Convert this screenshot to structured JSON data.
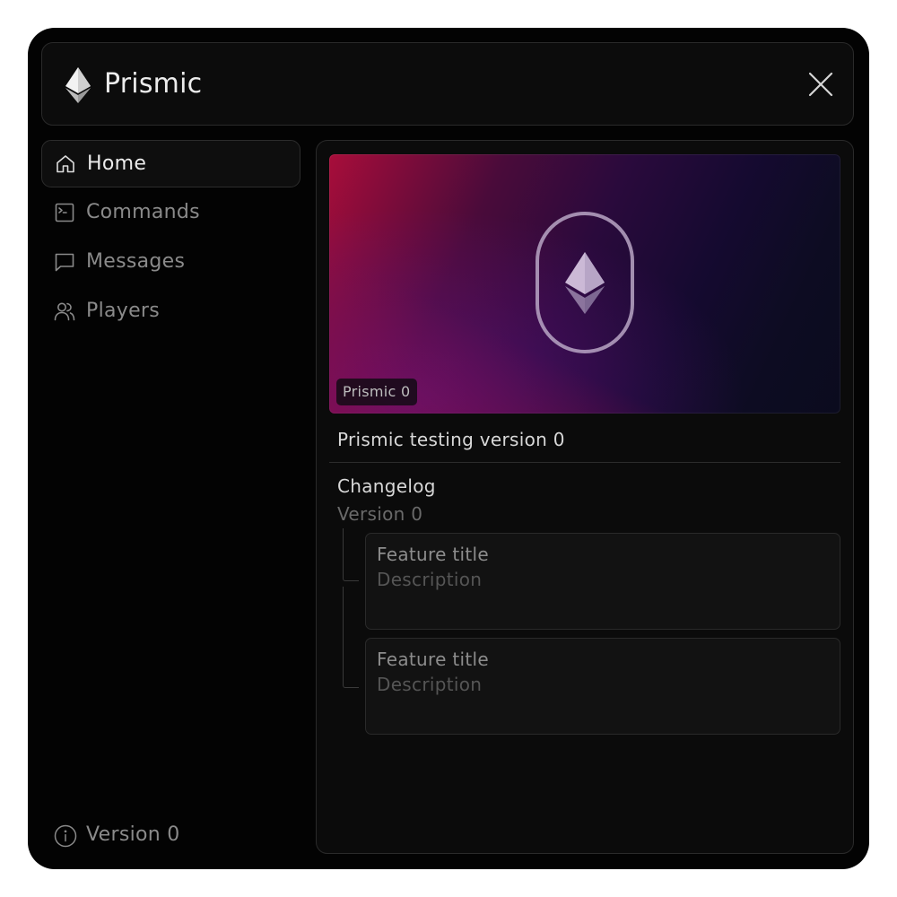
{
  "app": {
    "title": "Prismic",
    "logo_icon": "diamond-gem-icon",
    "close_icon": "close-icon"
  },
  "sidebar": {
    "items": [
      {
        "label": "Home",
        "icon": "home-icon",
        "active": true
      },
      {
        "label": "Commands",
        "icon": "terminal-icon",
        "active": false
      },
      {
        "label": "Messages",
        "icon": "message-square-icon",
        "active": false
      },
      {
        "label": "Players",
        "icon": "users-icon",
        "active": false
      }
    ],
    "footer": {
      "label": "Version 0",
      "icon": "info-icon"
    }
  },
  "main": {
    "banner": {
      "badge": "Prismic 0",
      "emblem_icon": "diamond-gem-icon"
    },
    "version_title": "Prismic testing version 0",
    "changelog": {
      "title": "Changelog",
      "version": "Version 0",
      "entries": [
        {
          "title": "Feature title",
          "description": "Description"
        },
        {
          "title": "Feature title",
          "description": "Description"
        }
      ]
    }
  },
  "colors": {
    "window_bg": "#030303",
    "panel_bg": "#0b0b0b",
    "border": "#2a2a2a",
    "text_primary": "#ececec",
    "text_muted": "#8a8a8a",
    "banner_accent_red": "#a80d3a",
    "banner_accent_purple": "#2a0a3c"
  }
}
